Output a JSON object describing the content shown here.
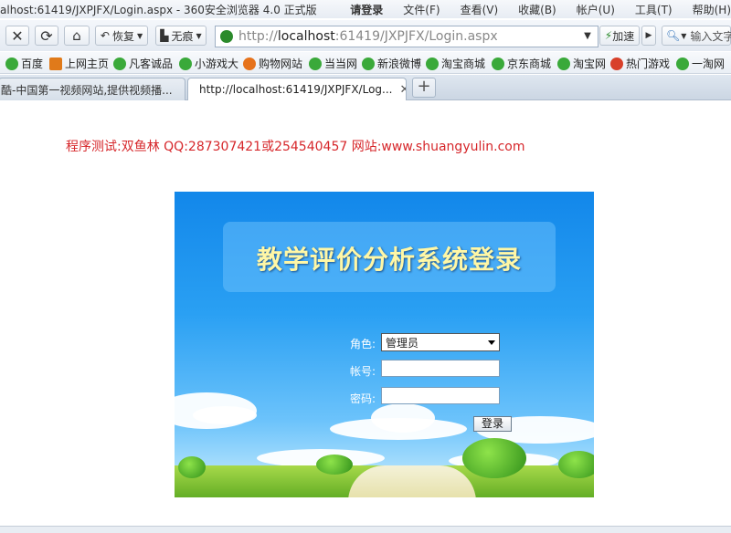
{
  "window": {
    "title": "alhost:61419/JXPJFX/Login.aspx - 360安全浏览器 4.0 正式版",
    "menus": [
      "请登录",
      "文件(F)",
      "查看(V)",
      "收藏(B)",
      "帐户(U)",
      "工具(T)",
      "帮助(H)"
    ]
  },
  "toolbar": {
    "restore_label": "恢复",
    "notrace_label": "无痕",
    "address_prefix": "http://",
    "address_host": "localhost",
    "address_rest": ":61419/JXPJFX/Login.aspx",
    "speed_label": "加速",
    "search_placeholder": "输入文字"
  },
  "bookmarks": [
    "百度",
    "上网主页",
    "凡客诚品",
    "小游戏大",
    "购物网站",
    "当当网",
    "新浪微博",
    "淘宝商城",
    "京东商城",
    "淘宝网",
    "热门游戏",
    "一淘网"
  ],
  "tabs": [
    {
      "label": "酷-中国第一视频网站,提供视频播...",
      "active": false
    },
    {
      "label": "http://localhost:61419/JXPJFX/Log...",
      "active": true
    }
  ],
  "page": {
    "notice": "程序测试:双鱼林 QQ:287307421或254540457 网站:www.shuangyulin.com",
    "login": {
      "title": "教学评价分析系统登录",
      "role_label": "角色:",
      "role_value": "管理员",
      "account_label": "帐号:",
      "account_value": "",
      "password_label": "密码:",
      "password_value": "",
      "submit_label": "登录"
    }
  }
}
